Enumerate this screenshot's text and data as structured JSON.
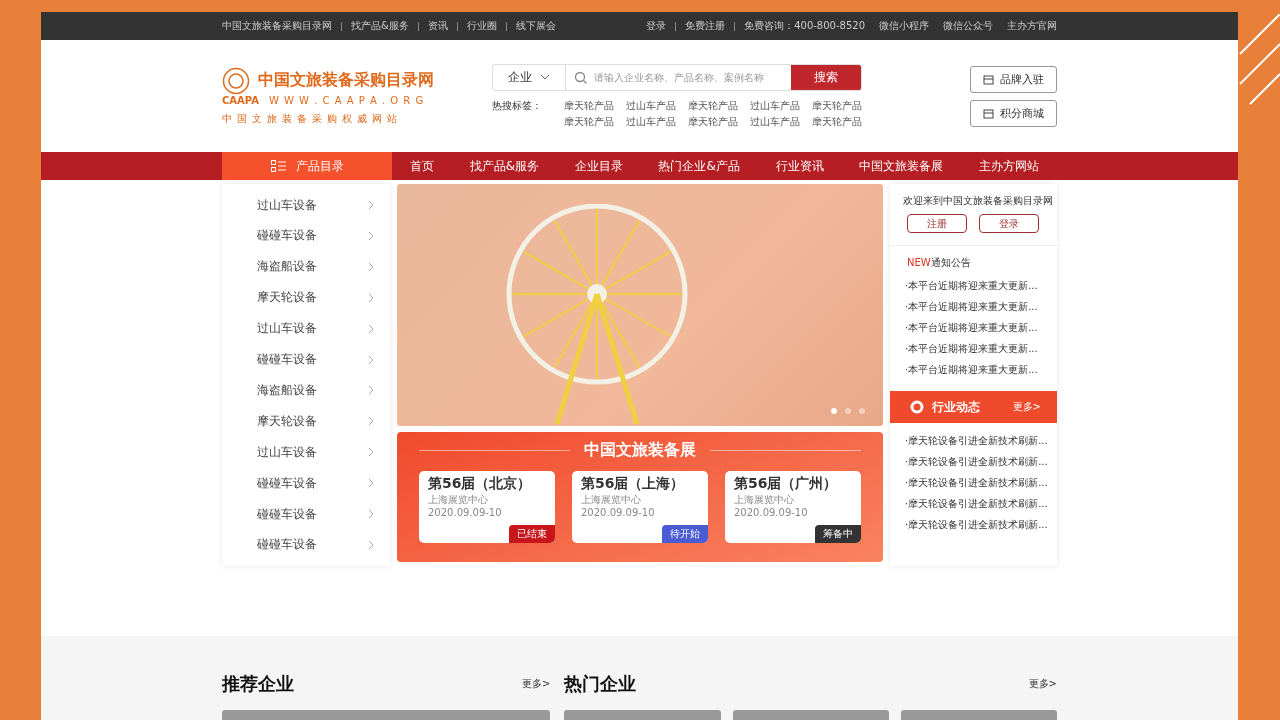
{
  "top_bar": {
    "left_links": [
      "中国文旅装备采购目录网",
      "找产品&服务",
      "资讯",
      "行业圈",
      "线下展会"
    ],
    "right_links": [
      "登录",
      "免费注册",
      "免费咨询：400-800-8520",
      "微信小程序",
      "微信公众号",
      "主办方官网"
    ]
  },
  "header": {
    "logo": {
      "title": "中国文旅装备采购目录网",
      "abbr": "CAAPA",
      "url": "W W W . C A A P A . O R G",
      "slogan": "中国文旅装备采购权威网站"
    },
    "search": {
      "scope": "企业",
      "placeholder": "请输入企业名称、产品名称、案例名称",
      "button": "搜索",
      "hot_label": "热搜标签：",
      "hot_tags": [
        "摩天轮产品",
        "过山车产品",
        "摩天轮产品",
        "过山车产品",
        "摩天轮产品",
        "摩天轮产品",
        "过山车产品",
        "摩天轮产品",
        "过山车产品",
        "摩天轮产品"
      ]
    },
    "buttons": [
      "品牌入驻",
      "积分商城"
    ]
  },
  "nav": {
    "category_button": "产品目录",
    "items": [
      "首页",
      "找产品&服务",
      "企业目录",
      "热门企业&产品",
      "行业资讯",
      "中国文旅装备展",
      "主办方网站"
    ]
  },
  "categories": [
    "过山车设备",
    "碰碰车设备",
    "海盗船设备",
    "摩天轮设备",
    "过山车设备",
    "碰碰车设备",
    "海盗船设备",
    "摩天轮设备",
    "过山车设备",
    "碰碰车设备",
    "碰碰车设备",
    "碰碰车设备"
  ],
  "banner": {
    "dots": [
      {
        "selected": true
      },
      {
        "selected": false
      },
      {
        "selected": false
      }
    ]
  },
  "expo": {
    "title": "中国文旅装备展",
    "cards": [
      {
        "title": "第56届（北京）",
        "venue": "上海展览中心",
        "date": "2020.09.09-10",
        "status": "已结束",
        "color": "#c8161d"
      },
      {
        "title": "第56届（上海）",
        "venue": "上海展览中心",
        "date": "2020.09.09-10",
        "status": "待开始",
        "color": "#4a5bd4"
      },
      {
        "title": "第56届（广州）",
        "venue": "上海展览中心",
        "date": "2020.09.09-10",
        "status": "筹备中",
        "color": "#333333"
      }
    ]
  },
  "sidebar": {
    "welcome": "欢迎来到中国文旅装备采购目录网",
    "buttons": [
      "注册",
      "登录"
    ],
    "notice_badge": "NEW",
    "notice_title": "通知公告",
    "notices": [
      "·本平台近期将迎来重大更新...",
      "·本平台近期将迎来重大更新...",
      "·本平台近期将迎来重大更新...",
      "·本平台近期将迎来重大更新...",
      "·本平台近期将迎来重大更新..."
    ],
    "news_title": "行业动态",
    "news_more": "更多>",
    "news": [
      "·摩天轮设备引进全新技术刷新...",
      "·摩天轮设备引进全新技术刷新...",
      "·摩天轮设备引进全新技术刷新...",
      "·摩天轮设备引进全新技术刷新...",
      "·摩天轮设备引进全新技术刷新..."
    ]
  },
  "sections": [
    {
      "title": "推荐企业",
      "more": "更多>"
    },
    {
      "title": "热门企业",
      "more": "更多>"
    }
  ]
}
